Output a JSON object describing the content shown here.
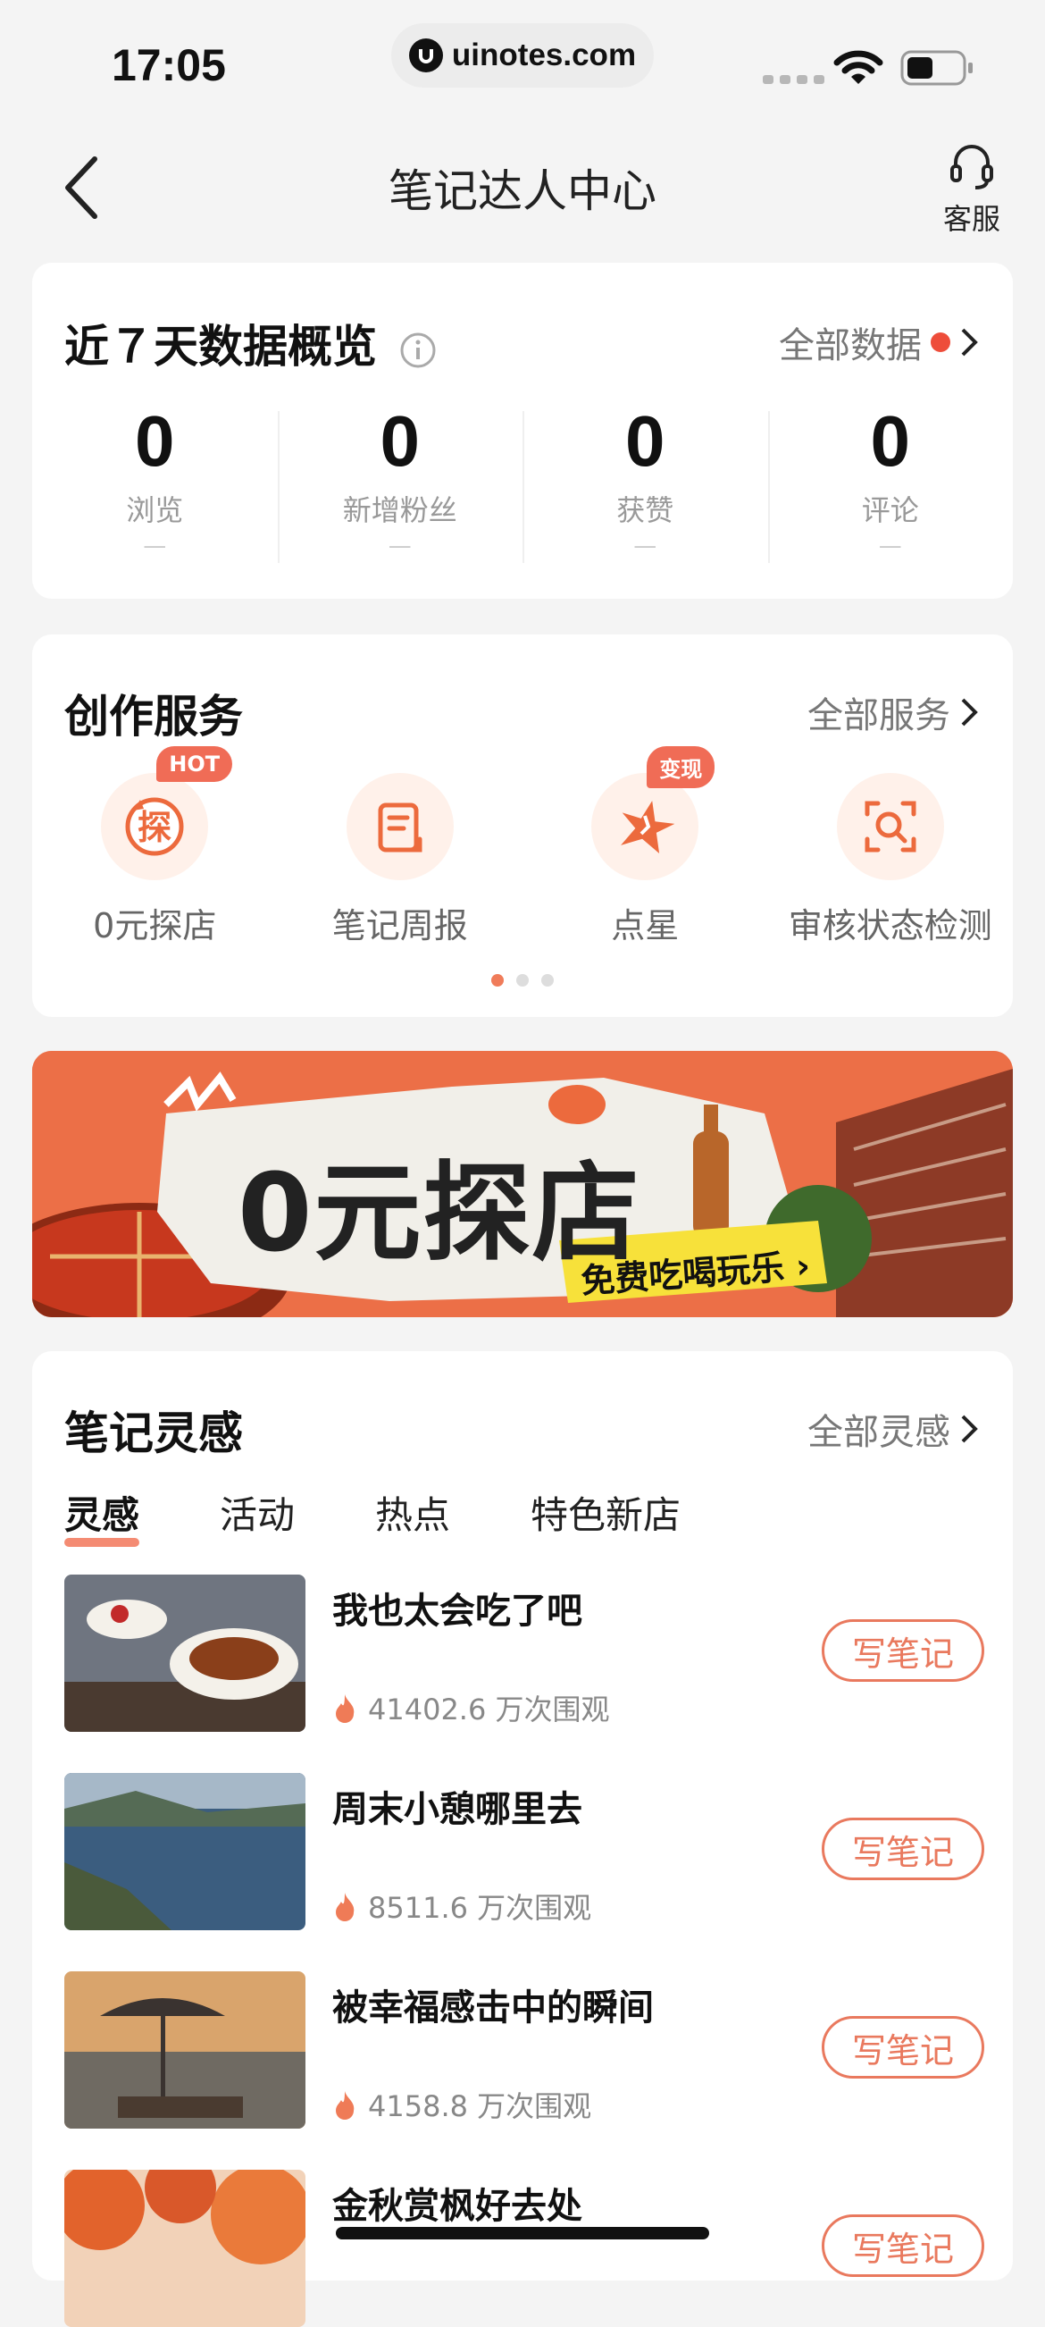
{
  "status_bar": {
    "time": "17:05",
    "url": "uinotes.com"
  },
  "nav": {
    "title": "笔记达人中心",
    "support_label": "客服"
  },
  "overview": {
    "title": "近７天数据概览",
    "link_label": "全部数据",
    "stats": [
      {
        "value": "0",
        "label": "浏览",
        "sub": "—"
      },
      {
        "value": "0",
        "label": "新增粉丝",
        "sub": "—"
      },
      {
        "value": "0",
        "label": "获赞",
        "sub": "—"
      },
      {
        "value": "0",
        "label": "评论",
        "sub": "—"
      }
    ]
  },
  "services": {
    "title": "创作服务",
    "link_label": "全部服务",
    "items": [
      {
        "label": "0元探店",
        "badge": "HOT",
        "icon": "explore-shop-icon"
      },
      {
        "label": "笔记周报",
        "badge": "",
        "icon": "weekly-report-icon"
      },
      {
        "label": "点星",
        "badge": "变现",
        "icon": "star-icon"
      },
      {
        "label": "审核状态检测",
        "badge": "",
        "icon": "scan-search-icon"
      }
    ],
    "page_count": 3,
    "active_page": 1
  },
  "banner": {
    "headline": "0元探店",
    "cta": "免费吃喝玩乐 ›"
  },
  "inspiration": {
    "title": "笔记灵感",
    "link_label": "全部灵感",
    "tabs": [
      "灵感",
      "活动",
      "热点",
      "特色新店"
    ],
    "active_tab": 0,
    "items": [
      {
        "title": "我也太会吃了吧",
        "views": "41402.6 万次围观",
        "button": "写笔记"
      },
      {
        "title": "周末小憩哪里去",
        "views": "8511.6 万次围观",
        "button": "写笔记"
      },
      {
        "title": "被幸福感击中的瞬间",
        "views": "4158.8 万次围观",
        "button": "写笔记"
      },
      {
        "title": "金秋赏枫好去处",
        "views": "",
        "button": "写笔记"
      }
    ]
  },
  "colors": {
    "accent": "#e9795e",
    "red_dot": "#ee4d3a",
    "page_bg": "#f4f4f4"
  }
}
